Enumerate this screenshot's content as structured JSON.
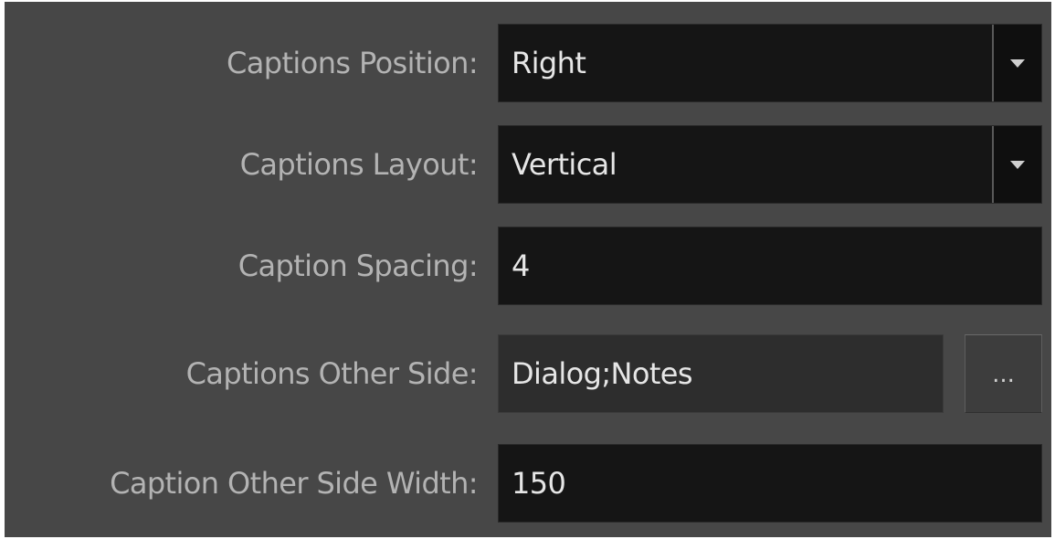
{
  "rows": [
    {
      "label": "Captions Position:",
      "value": "Right",
      "kind": "combo"
    },
    {
      "label": "Captions Layout:",
      "value": "Vertical",
      "kind": "combo"
    },
    {
      "label": "Caption Spacing:",
      "value": "4",
      "kind": "text"
    },
    {
      "label": "Captions Other Side:",
      "value": "Dialog;Notes",
      "kind": "readonly-with-button",
      "button_label": "..."
    },
    {
      "label": "Caption Other Side Width:",
      "value": "150",
      "kind": "text"
    }
  ],
  "icons": {
    "dropdown": "chevron-down-icon"
  },
  "colors": {
    "panel_bg": "#474747",
    "field_bg": "#151515",
    "label_text": "#b3b3b3",
    "value_text": "#e6e6e6"
  }
}
